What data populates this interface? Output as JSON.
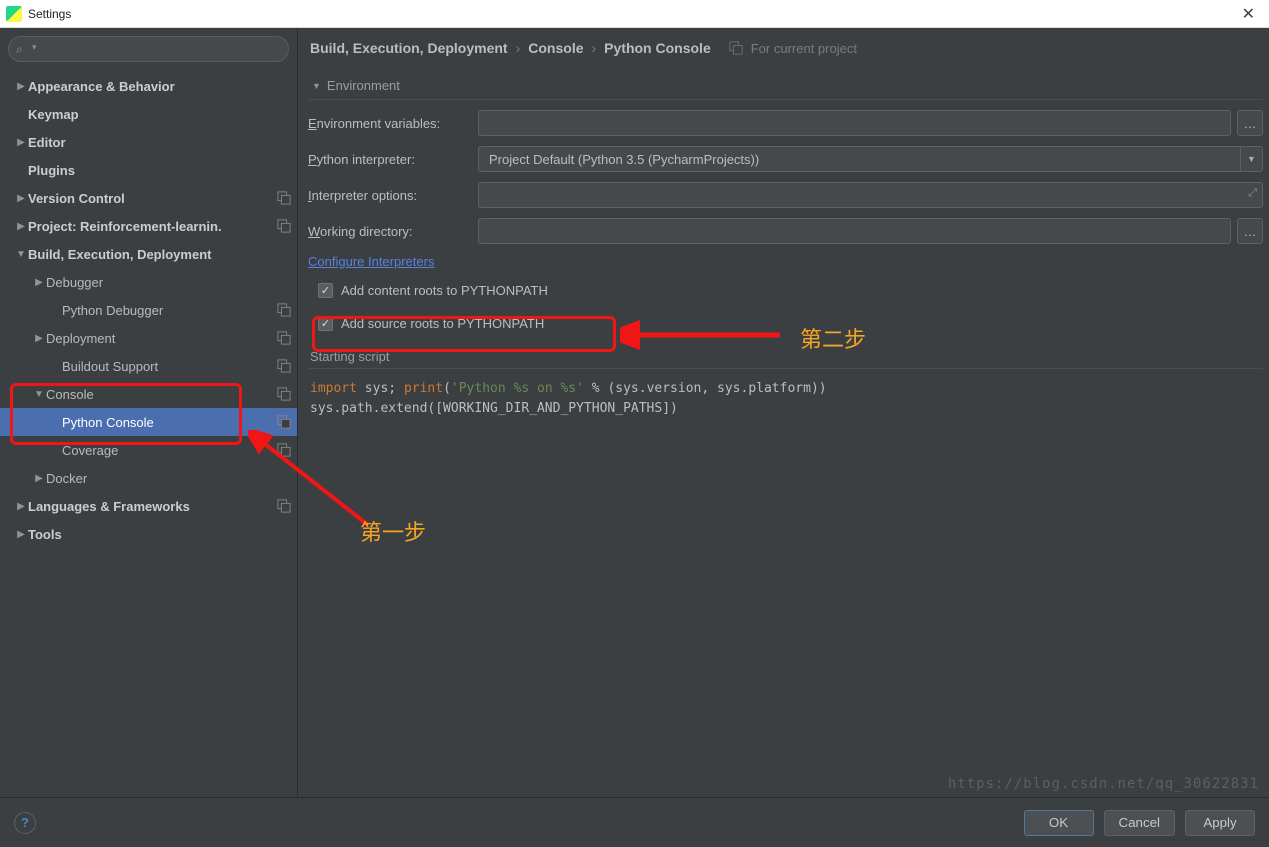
{
  "window": {
    "title": "Settings"
  },
  "sidebar": {
    "items": [
      {
        "label": "Appearance & Behavior",
        "bold": true,
        "depth": 0,
        "arrow": "▶"
      },
      {
        "label": "Keymap",
        "bold": true,
        "depth": 0,
        "arrow": ""
      },
      {
        "label": "Editor",
        "bold": true,
        "depth": 0,
        "arrow": "▶"
      },
      {
        "label": "Plugins",
        "bold": true,
        "depth": 0,
        "arrow": ""
      },
      {
        "label": "Version Control",
        "bold": true,
        "depth": 0,
        "arrow": "▶",
        "badge": true
      },
      {
        "label": "Project: Reinforcement-learnin.",
        "bold": true,
        "depth": 0,
        "arrow": "▶",
        "badge": true
      },
      {
        "label": "Build, Execution, Deployment",
        "bold": true,
        "depth": 0,
        "arrow": "▼"
      },
      {
        "label": "Debugger",
        "bold": false,
        "depth": 1,
        "arrow": "▶"
      },
      {
        "label": "Python Debugger",
        "bold": false,
        "depth": 2,
        "arrow": "",
        "badge": true
      },
      {
        "label": "Deployment",
        "bold": false,
        "depth": 1,
        "arrow": "▶",
        "badge": true
      },
      {
        "label": "Buildout Support",
        "bold": false,
        "depth": 2,
        "arrow": "",
        "badge": true
      },
      {
        "label": "Console",
        "bold": false,
        "depth": 1,
        "arrow": "▼",
        "badge": true
      },
      {
        "label": "Python Console",
        "bold": false,
        "depth": 2,
        "arrow": "",
        "badge": true,
        "selected": true
      },
      {
        "label": "Coverage",
        "bold": false,
        "depth": 2,
        "arrow": "",
        "badge": true
      },
      {
        "label": "Docker",
        "bold": false,
        "depth": 1,
        "arrow": "▶"
      },
      {
        "label": "Languages & Frameworks",
        "bold": true,
        "depth": 0,
        "arrow": "▶",
        "badge": true
      },
      {
        "label": "Tools",
        "bold": true,
        "depth": 0,
        "arrow": "▶"
      }
    ]
  },
  "breadcrumbs": {
    "part1": "Build, Execution, Deployment",
    "part2": "Console",
    "part3": "Python Console",
    "scope": "For current project"
  },
  "form": {
    "section": "Environment",
    "env_label_pre": "E",
    "env_label_rest": "nvironment variables:",
    "interp_label_pre": "P",
    "interp_label_rest": "ython interpreter:",
    "interp_value": "Project Default (Python 3.5 (PycharmProjects))",
    "opts_label_pre": "I",
    "opts_label_rest": "nterpreter options:",
    "wd_label_pre": "W",
    "wd_label_rest": "orking directory:",
    "config_link": "Configure Interpreters",
    "chk1": "Add content roots to PYTHONPATH",
    "chk2": "Add source roots to PYTHONPATH",
    "script_label": "Starting script",
    "code_kw1": "import",
    "code_p1": " sys; ",
    "code_kw2": "print",
    "code_p2": "(",
    "code_str": "'Python %s on %s'",
    "code_p3": " % (sys.version, sys.platform))",
    "code_line2": "sys.path.extend([WORKING_DIR_AND_PYTHON_PATHS])"
  },
  "buttons": {
    "ok": "OK",
    "cancel": "Cancel",
    "apply": "Apply"
  },
  "annotations": {
    "step1": "第一步",
    "step2": "第二步"
  },
  "watermark": "https://blog.csdn.net/qq_30622831"
}
